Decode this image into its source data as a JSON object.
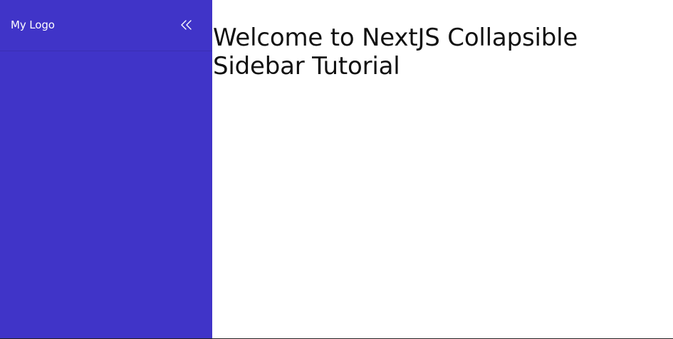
{
  "sidebar": {
    "logo_text": "My Logo",
    "collapse_icon": "chevrons-left-icon",
    "background_color": "#4034c8"
  },
  "main": {
    "title": "Welcome to NextJS Collapsible Sidebar Tutorial"
  }
}
